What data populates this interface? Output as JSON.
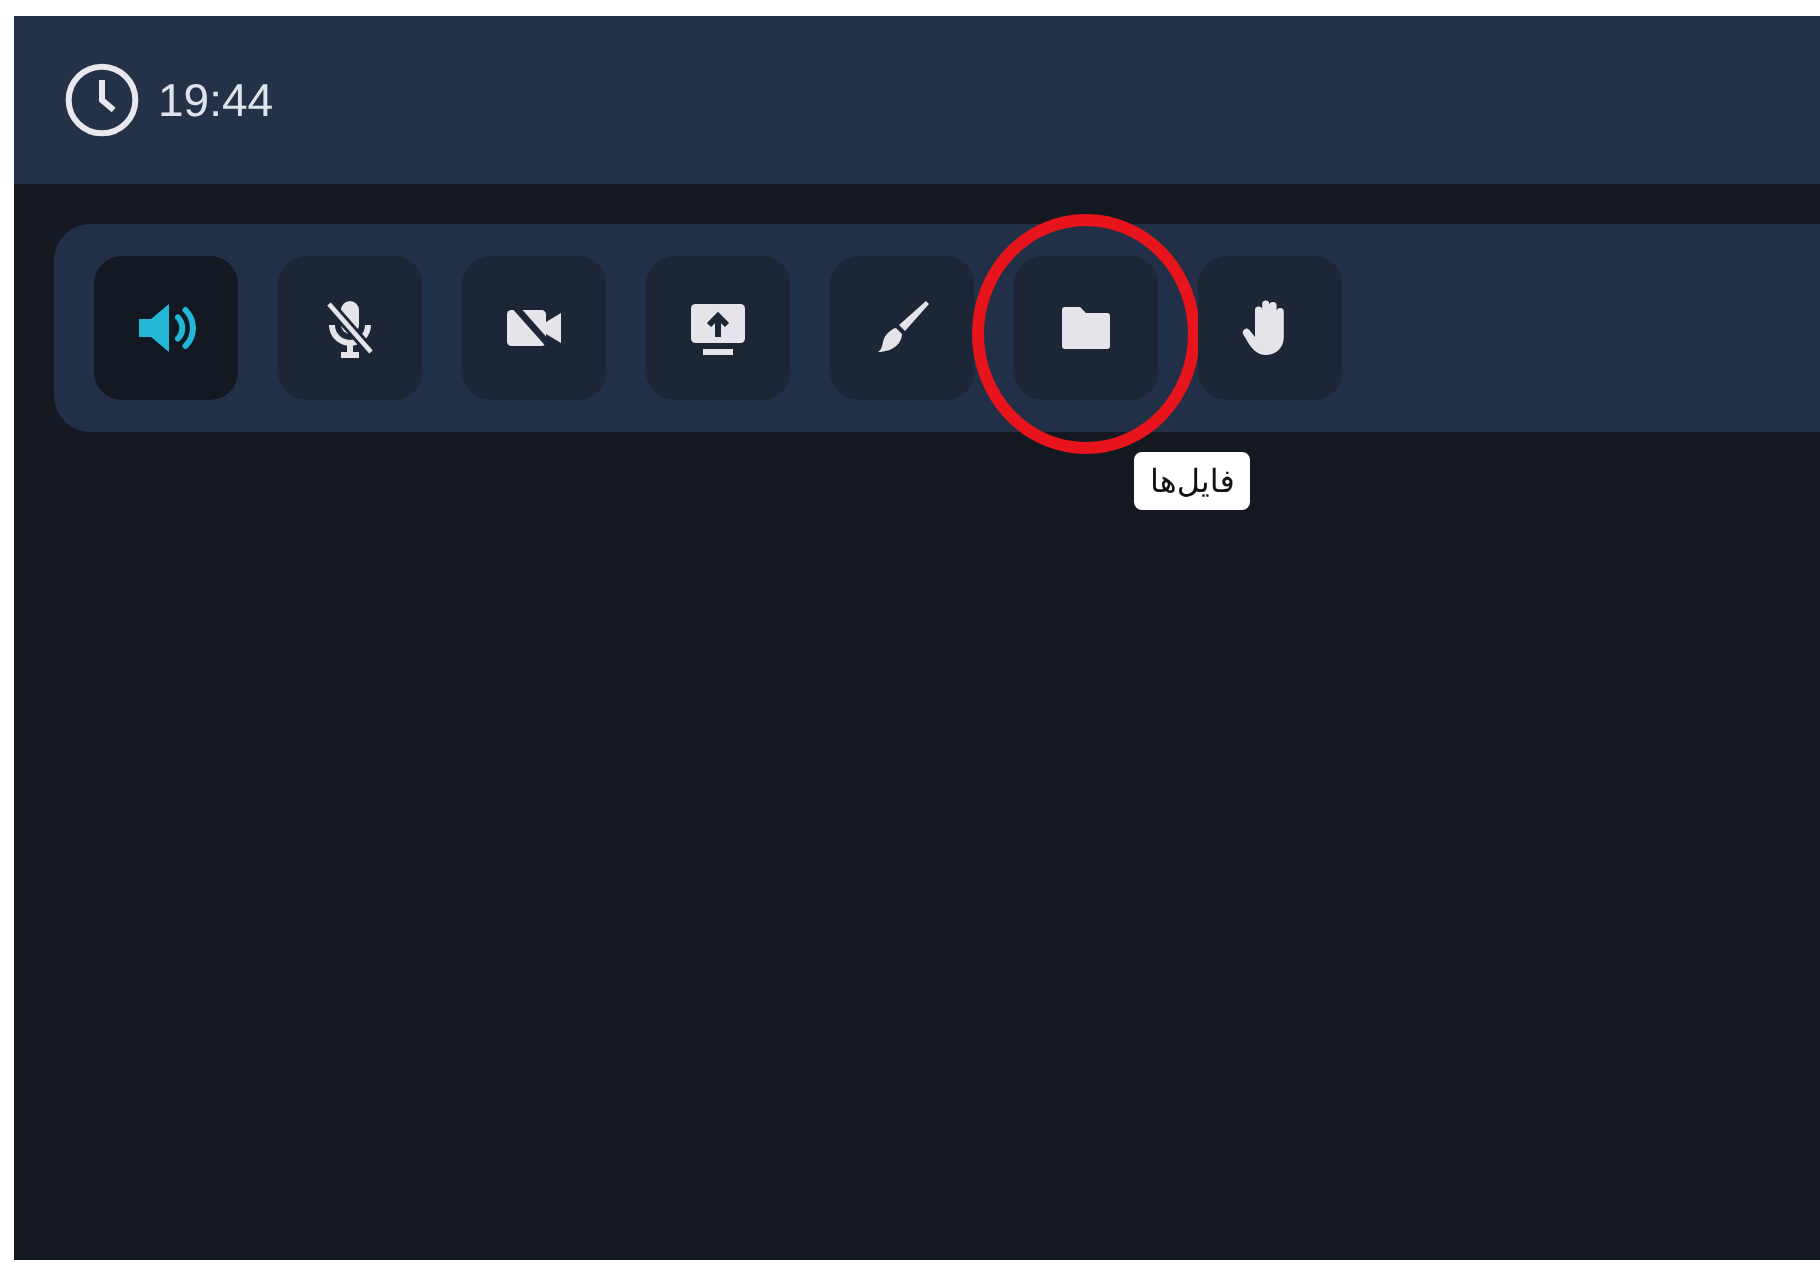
{
  "header": {
    "time": "19:44"
  },
  "toolbar": {
    "buttons": [
      {
        "kind": "speaker",
        "selected": true,
        "highlighted": false
      },
      {
        "kind": "mic-off",
        "selected": false,
        "highlighted": false
      },
      {
        "kind": "camera-off",
        "selected": false,
        "highlighted": false
      },
      {
        "kind": "screen-share",
        "selected": false,
        "highlighted": false
      },
      {
        "kind": "brush",
        "selected": false,
        "highlighted": false
      },
      {
        "kind": "folder",
        "selected": false,
        "highlighted": true,
        "tooltip": "فایل‌ها"
      },
      {
        "kind": "hand",
        "selected": false,
        "highlighted": false
      }
    ]
  }
}
